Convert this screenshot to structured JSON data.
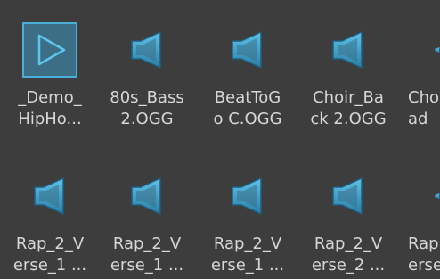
{
  "files": [
    {
      "icon": "play-icon",
      "line1": "_Demo_",
      "line2": "HipHo..."
    },
    {
      "icon": "audio-file-icon",
      "line1": "80s_Bass",
      "line2": "2.OGG"
    },
    {
      "icon": "audio-file-icon",
      "line1": "BeatToG",
      "line2": "o C.OGG"
    },
    {
      "icon": "audio-file-icon",
      "line1": "Choir_Ba",
      "line2": "ck 2.OGG"
    },
    {
      "icon": "audio-file-icon",
      "line1": "Cho",
      "line2": "ad"
    },
    {
      "icon": "audio-file-icon",
      "line1": "Rap_2_V",
      "line2": "erse_1 ..."
    },
    {
      "icon": "audio-file-icon",
      "line1": "Rap_2_V",
      "line2": "erse_1 ..."
    },
    {
      "icon": "audio-file-icon",
      "line1": "Rap_2_V",
      "line2": "erse_1 ..."
    },
    {
      "icon": "audio-file-icon",
      "line1": "Rap_2_V",
      "line2": "erse_2 ..."
    },
    {
      "icon": "audio-file-icon",
      "line1": "Rap",
      "line2": "erse"
    }
  ],
  "colors": {
    "background": "#3d3d3d",
    "label": "#d6d6d6",
    "icon_accent": "#4ab0da"
  }
}
